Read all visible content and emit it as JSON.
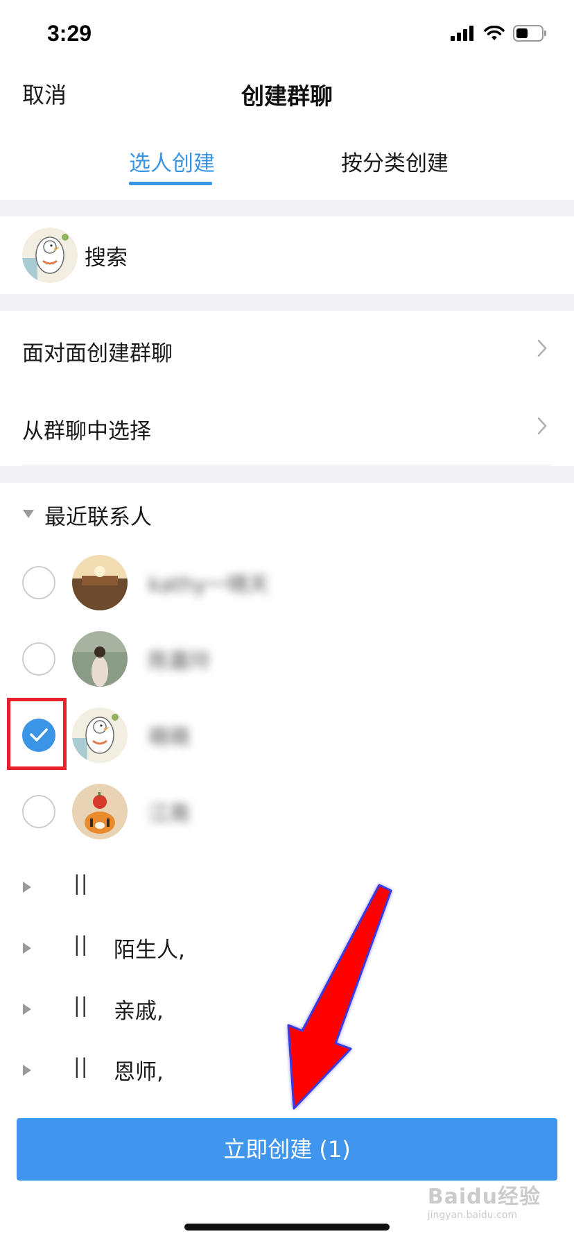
{
  "status_bar": {
    "time": "3:29",
    "icons": [
      "signal-icon",
      "wifi-icon",
      "battery-icon"
    ]
  },
  "nav": {
    "cancel_label": "取消",
    "title": "创建群聊"
  },
  "tabs": [
    {
      "label": "选人创建",
      "active": true
    },
    {
      "label": "按分类创建",
      "active": false
    }
  ],
  "search": {
    "label": "搜索"
  },
  "menu": [
    {
      "label": "面对面创建群聊"
    },
    {
      "label": "从群聊中选择"
    }
  ],
  "recent": {
    "label": "最近联系人",
    "contacts": [
      {
        "name": "kathy一晴天",
        "checked": false
      },
      {
        "name": "陈嘉玲",
        "checked": false
      },
      {
        "name": "萌萌",
        "checked": true
      },
      {
        "name": "江南",
        "checked": false
      }
    ]
  },
  "groups": [
    {
      "bars": "||",
      "name": ""
    },
    {
      "bars": "||",
      "name": "陌生人,"
    },
    {
      "bars": "||",
      "name": "亲戚,"
    },
    {
      "bars": "||",
      "name": "恩师,"
    }
  ],
  "create_button": {
    "label": "立即创建 (1)"
  },
  "watermark": {
    "brand": "Baidu经验",
    "url": "jingyan.baidu.com"
  },
  "colors": {
    "accent": "#3b95e6",
    "button": "#4095ec",
    "highlight": "#e8212b",
    "arrow": "#ff0000"
  }
}
